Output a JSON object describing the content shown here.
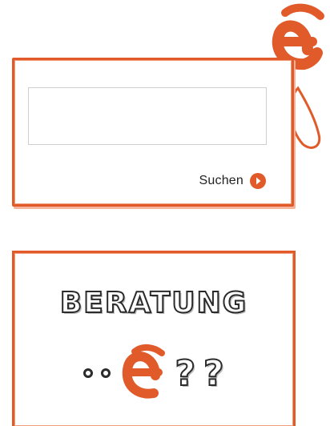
{
  "colors": {
    "brand_orange": "#e15a2a",
    "text_dark": "#222222",
    "input_border": "#cfcfcf"
  },
  "search": {
    "value": "",
    "placeholder": "",
    "submit_label": "Suchen",
    "submit_icon": "arrow-right-circle-icon"
  },
  "logo": {
    "icon": "e-logo-icon"
  },
  "beratung": {
    "title": "BERATUNG",
    "q1": "?",
    "q2": "?",
    "icon": "e-logo-icon"
  }
}
